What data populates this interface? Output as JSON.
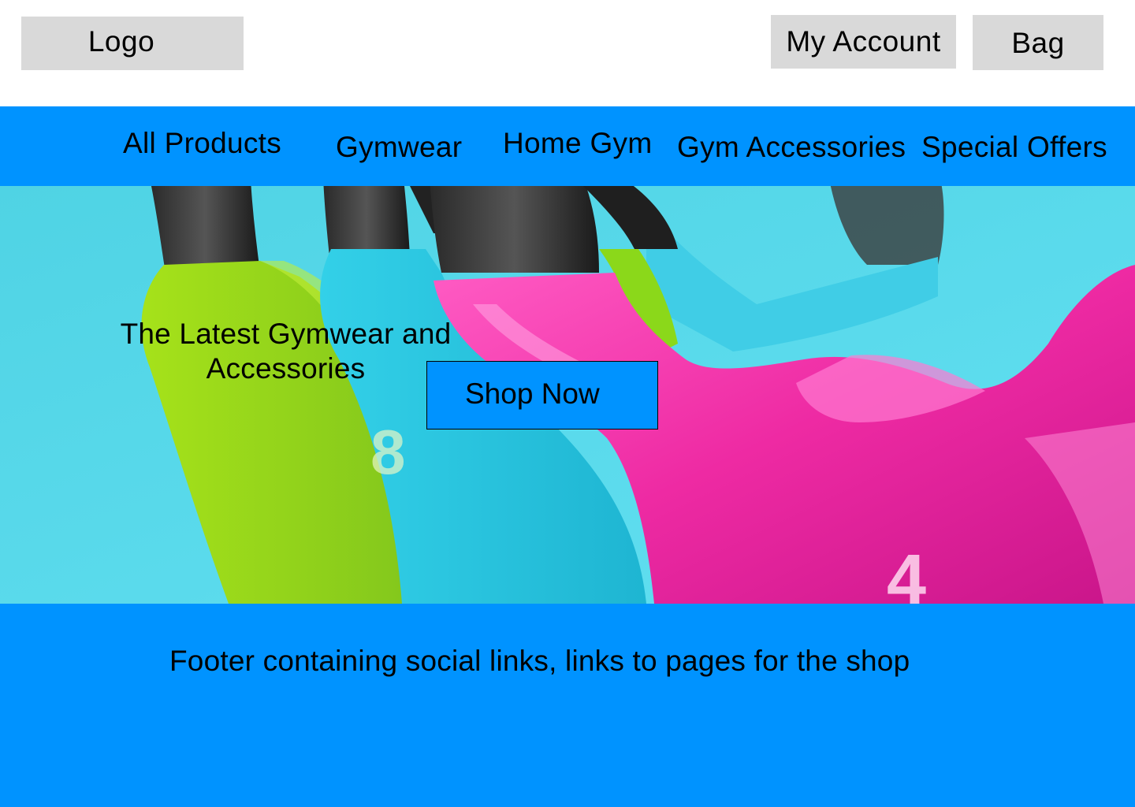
{
  "header": {
    "logo_label": "Logo",
    "account_label": "My Account",
    "bag_label": "Bag"
  },
  "nav": {
    "items": [
      {
        "label": "All Products"
      },
      {
        "label": "Gymwear"
      },
      {
        "label": "Home Gym"
      },
      {
        "label": "Gym Accessories"
      },
      {
        "label": "Special Offers"
      }
    ]
  },
  "hero": {
    "title_line1": "The Latest Gymwear and",
    "title_line2": "Accessories",
    "cta_label": "Shop Now",
    "image_numbers": [
      "8",
      "4"
    ]
  },
  "footer": {
    "text": "Footer containing social links, links to pages for the shop"
  },
  "colors": {
    "brand_blue": "#0093ff",
    "placeholder_gray": "#d9d9d9",
    "hero_background": "#52d2e6",
    "kettlebell_green": "#8fd11f",
    "kettlebell_cyan": "#29c6e3",
    "kettlebell_pink": "#f02aa8"
  }
}
